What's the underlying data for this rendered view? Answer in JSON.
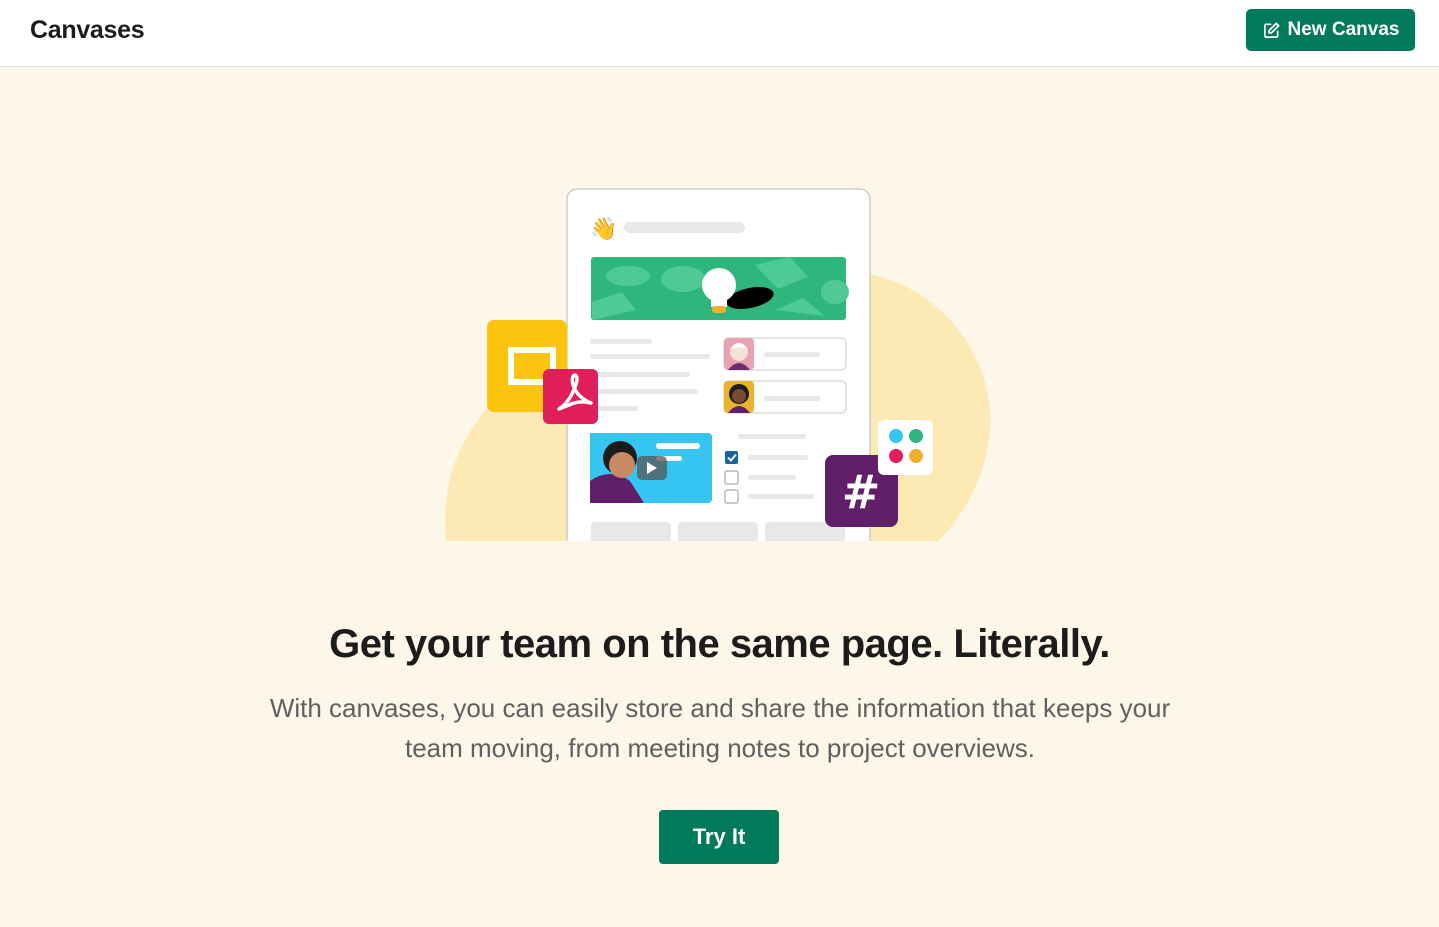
{
  "header": {
    "title": "Canvases",
    "new_canvas_label": "New Canvas",
    "new_canvas_icon": "compose-icon"
  },
  "main": {
    "headline": "Get your team on the same page. Literally.",
    "description": "With canvases, you can easily store and share the information that keeps your team moving, from meeting notes to project overviews.",
    "cta_label": "Try It"
  },
  "illustration": {
    "wave_emoji": "👋",
    "channel_symbol": "#",
    "icons": [
      "slides-icon",
      "pdf-icon",
      "channel-icon",
      "slack-logo-icon",
      "lightbulb-icon",
      "play-icon",
      "checkbox-icon"
    ]
  },
  "colors": {
    "accent": "#007a5a",
    "background": "#fdf7ea",
    "header_bg": "#ffffff",
    "blob": "#fde9b4",
    "slides_yellow": "#fbc40f",
    "pdf_red": "#e01e5a",
    "channel_purple": "#611f69",
    "banner_green": "#2eb67d",
    "video_blue": "#36c5f0"
  }
}
